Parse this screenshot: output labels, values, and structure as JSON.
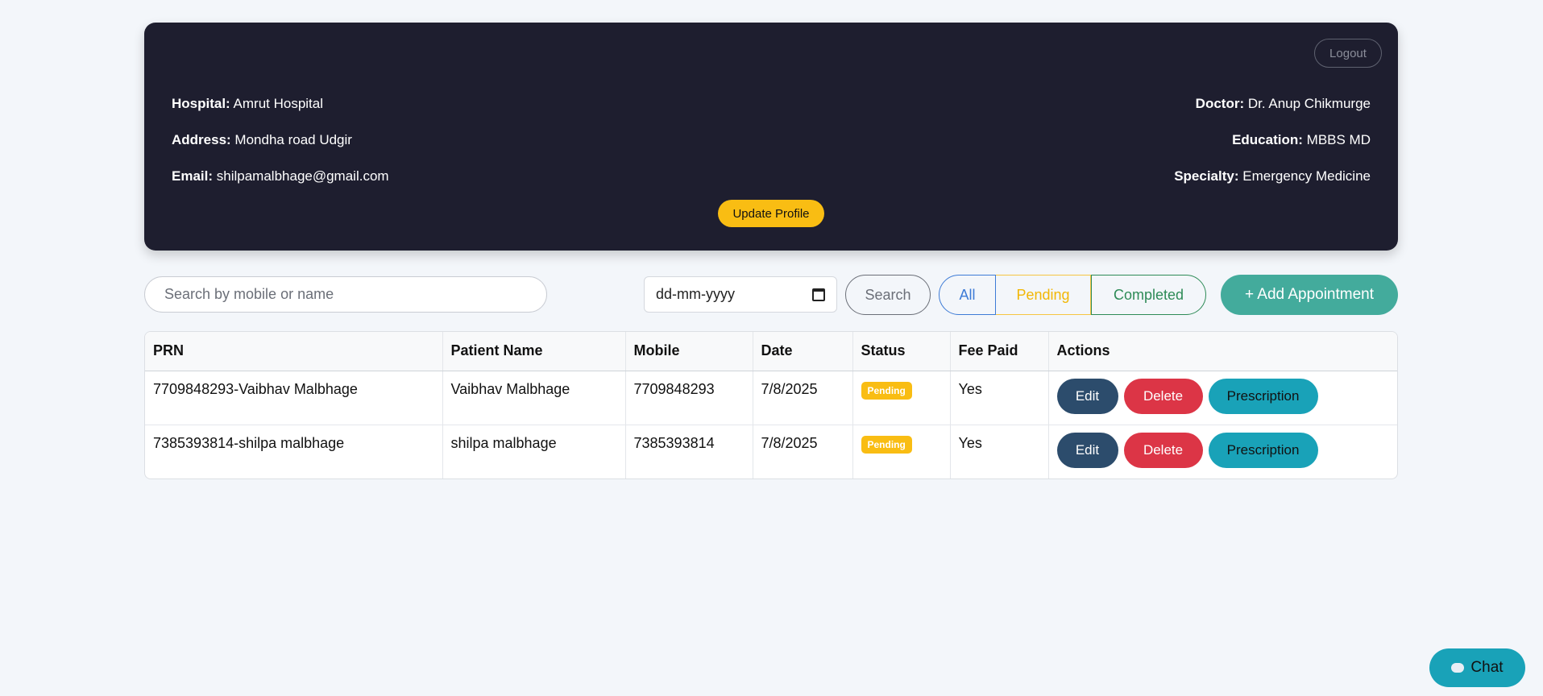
{
  "header": {
    "logout_label": "Logout",
    "hospital_label": "Hospital:",
    "hospital": "Amrut Hospital",
    "address_label": "Address:",
    "address": "Mondha road Udgir",
    "email_label": "Email:",
    "email": "shilpamalbhage@gmail.com",
    "doctor_label": "Doctor:",
    "doctor": "Dr. Anup Chikmurge",
    "education_label": "Education:",
    "education": "MBBS MD",
    "specialty_label": "Specialty:",
    "specialty": "Emergency Medicine",
    "update_label": "Update Profile"
  },
  "toolbar": {
    "search_placeholder": "Search by mobile or name",
    "date_placeholder": "dd-mm-yyyy",
    "search_label": "Search",
    "filters": {
      "all": "All",
      "pending": "Pending",
      "completed": "Completed"
    },
    "add_label": "+ Add Appointment"
  },
  "table": {
    "columns": [
      "PRN",
      "Patient Name",
      "Mobile",
      "Date",
      "Status",
      "Fee Paid",
      "Actions"
    ],
    "rows": [
      {
        "prn": "7709848293-Vaibhav Malbhage",
        "name": "Vaibhav Malbhage",
        "mobile": "7709848293",
        "date": "7/8/2025",
        "status": "Pending",
        "fee": "Yes"
      },
      {
        "prn": "7385393814-shilpa malbhage",
        "name": "shilpa malbhage",
        "mobile": "7385393814",
        "date": "7/8/2025",
        "status": "Pending",
        "fee": "Yes"
      }
    ],
    "actions": {
      "edit": "Edit",
      "delete": "Delete",
      "prescription": "Prescription"
    }
  },
  "chat": {
    "label": "Chat",
    "icon": "chat-bubble-icon"
  },
  "colors": {
    "header_bg": "#1e1e2f",
    "accent_yellow": "#f9bd13",
    "add_button": "#43ab9c",
    "edit_button": "#2c4c6c",
    "delete_button": "#dc3546",
    "prescription_button": "#19a2b8"
  }
}
